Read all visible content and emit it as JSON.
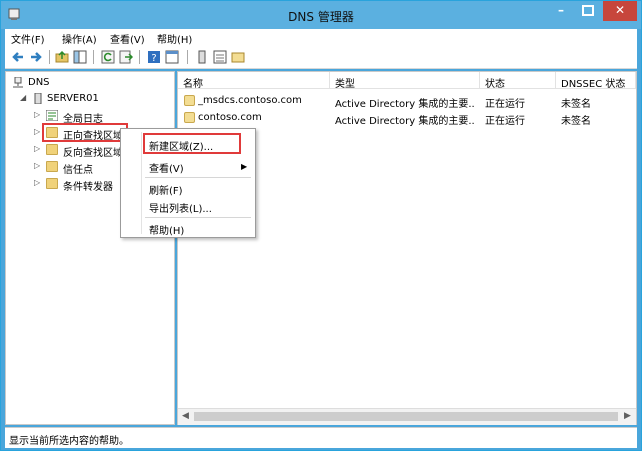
{
  "window": {
    "title": "DNS 管理器"
  },
  "menu": [
    "文件(F)",
    "操作(A)",
    "查看(V)",
    "帮助(H)"
  ],
  "tree": {
    "root": "DNS",
    "server": "SERVER01",
    "items": [
      "全局日志",
      "正向查找区域",
      "反向查找区域",
      "信任点",
      "条件转发器"
    ]
  },
  "list": {
    "columns": [
      "名称",
      "类型",
      "状态",
      "DNSSEC 状态"
    ],
    "rows": [
      {
        "name": "_msdcs.contoso.com",
        "type": "Active Directory 集成的主要...",
        "status": "正在运行",
        "dnssec": "未签名"
      },
      {
        "name": "contoso.com",
        "type": "Active Directory 集成的主要...",
        "status": "正在运行",
        "dnssec": "未签名"
      }
    ]
  },
  "context_menu": {
    "items": [
      "新建区域(Z)...",
      "查看(V)",
      "刷新(F)",
      "导出列表(L)...",
      "帮助(H)"
    ]
  },
  "status_bar": "显示当前所选内容的帮助。",
  "colors": {
    "frame": "#4aa6db",
    "close": "#c7463c",
    "highlight": "#e03a3a",
    "folder": "#f0d27a"
  }
}
